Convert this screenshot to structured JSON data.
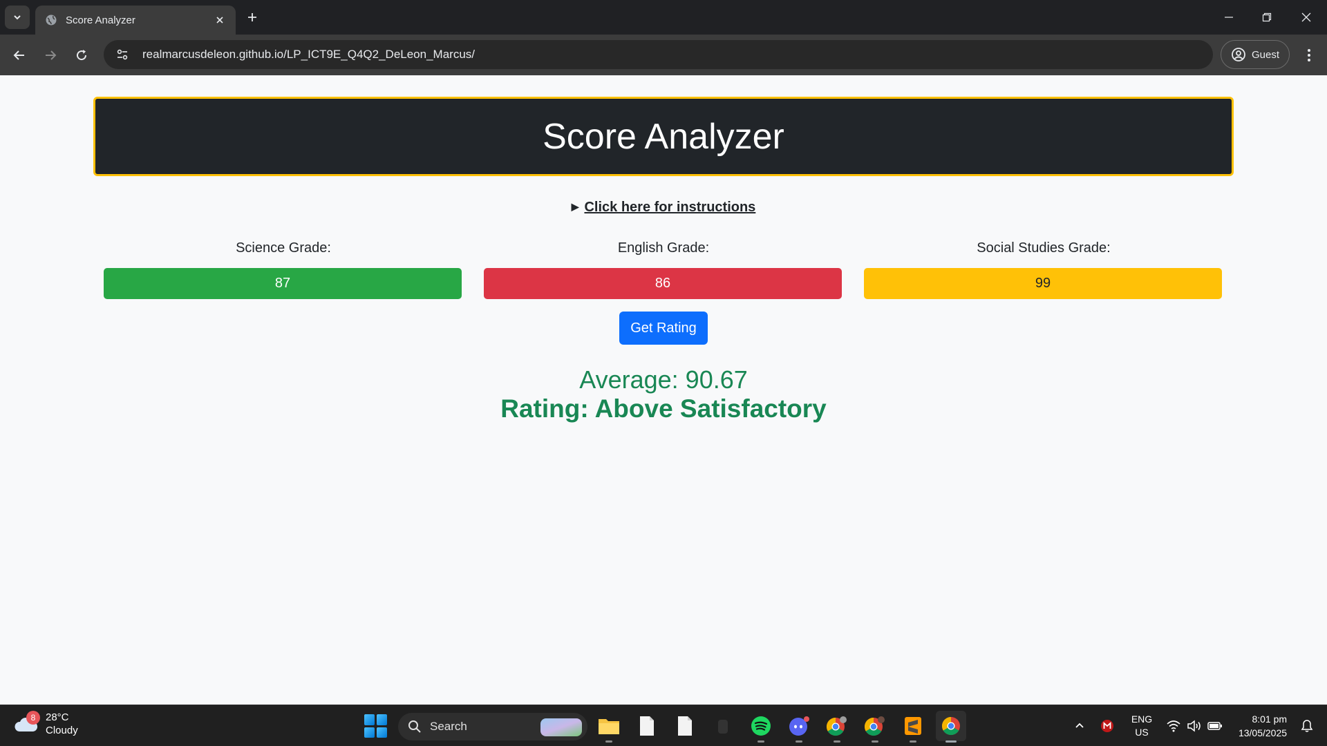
{
  "browser": {
    "tab_title": "Score Analyzer",
    "url_host": "realmarcusdeleon.github.io",
    "url_path": "/LP_ICT9E_Q4Q2_DeLeon_Marcus/",
    "profile_label": "Guest"
  },
  "page": {
    "title": "Score Analyzer",
    "instructions_link": "Click here for instructions",
    "grades": [
      {
        "label": "Science Grade:",
        "value": "87",
        "color": "#28a745"
      },
      {
        "label": "English Grade:",
        "value": "86",
        "color": "#dc3545"
      },
      {
        "label": "Social Studies Grade:",
        "value": "99",
        "color": "#ffc107"
      }
    ],
    "rating_button": "Get Rating",
    "average_text": "Average: 90.67",
    "rating_text": "Rating: Above Satisfactory",
    "accent_color": "#198754",
    "header_border_color": "#ffc107"
  },
  "taskbar": {
    "weather_temp": "28°C",
    "weather_desc": "Cloudy",
    "weather_badge": "8",
    "search_label": "Search",
    "lang_top": "ENG",
    "lang_bottom": "US",
    "time": "8:01 pm",
    "date": "13/05/2025",
    "apps": [
      "file-explorer",
      "notepad",
      "notepad",
      "app",
      "spotify",
      "discord",
      "chrome-profile",
      "chrome-profile",
      "sublime-text",
      "chrome"
    ],
    "tray_icons": [
      "chevron-up-icon",
      "mcafee-icon",
      "wifi-icon",
      "volume-icon",
      "battery-icon",
      "notification-icon"
    ]
  }
}
